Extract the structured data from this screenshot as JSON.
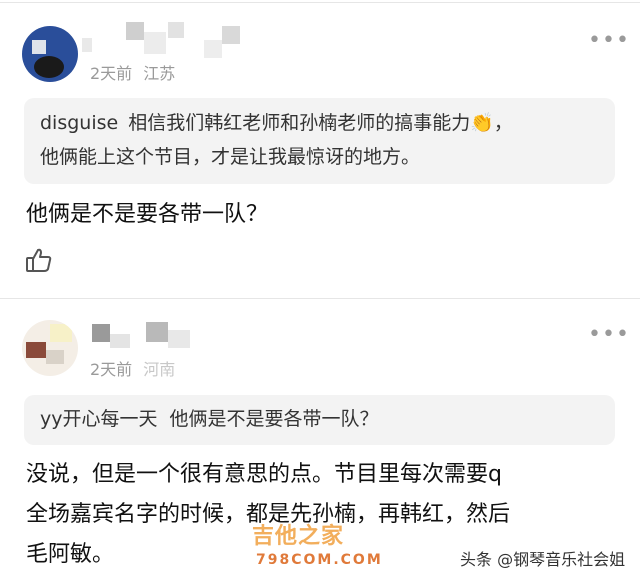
{
  "comments": [
    {
      "time": "2天前",
      "location": "江苏",
      "quote_user": "disguise",
      "quote_line1": "相信我们韩红老师和孙楠老师的搞事能力👏，",
      "quote_line2": "他俩能上这个节目，才是让我最惊讶的地方。",
      "body": "他俩是不是要各带一队？"
    },
    {
      "time": "2天前",
      "location": "河南",
      "quote_user": "yy开心每一天",
      "quote_text": "他俩是不是要各带一队？",
      "body_line1": "没说，但是一个很有意思的点。节目里每次需要q",
      "body_line2": "全场嘉宾名字的时候，都是先孙楠，再韩红，然后",
      "body_line3": "毛阿敏。"
    }
  ],
  "more_glyph": "•••",
  "watermark": {
    "main": "吉他之家",
    "sub": "798COM.COM"
  },
  "footer": {
    "prefix": "头条",
    "account": "@钢琴音乐社会姐"
  },
  "colors": {
    "divider": "#e6e6e6",
    "quote_bg": "#f3f3f3",
    "meta": "#9a9a9a"
  }
}
